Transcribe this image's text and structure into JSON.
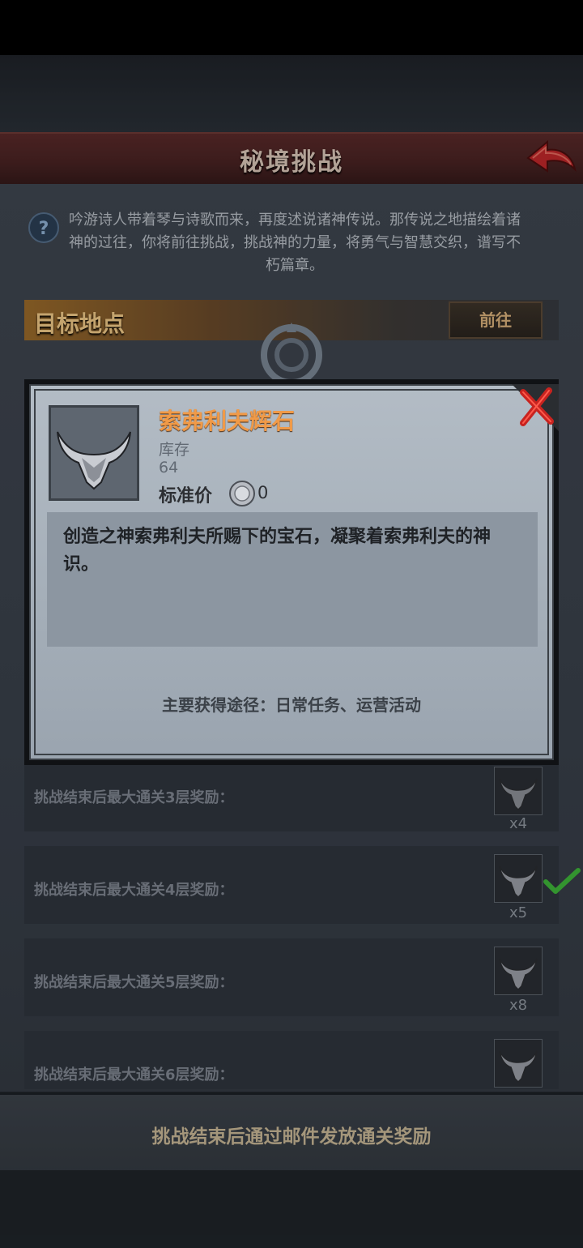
{
  "header": {
    "title": "秘境挑战"
  },
  "intro": {
    "text": "吟游诗人带着琴与诗歌而来，再度述说诸神传说。那传说之地描绘着诸神的过往，你将前往挑战，挑战神的力量，将勇气与智慧交织，谱写不朽篇章。"
  },
  "target": {
    "label": "目标地点",
    "goto_label": "前往"
  },
  "rewards": [
    {
      "label": "挑战结束后最大通关3层奖励：",
      "qty": "x4",
      "claimed": false
    },
    {
      "label": "挑战结束后最大通关4层奖励：",
      "qty": "x5",
      "claimed": true
    },
    {
      "label": "挑战结束后最大通关5层奖励：",
      "qty": "x8",
      "claimed": false
    },
    {
      "label": "挑战结束后最大通关6层奖励：",
      "qty": "",
      "claimed": false
    }
  ],
  "footer": {
    "text": "挑战结束后通过邮件发放通关奖励"
  },
  "modal": {
    "item_name": "索弗利夫辉石",
    "stock_label": "库存",
    "stock_value": "64",
    "price_label": "标准价",
    "price_value": "0",
    "description": "创造之神索弗利夫所赐下的宝石，凝聚着索弗利夫的神识。",
    "source": "主要获得途径：日常任务、运营活动"
  },
  "colors": {
    "header_red": "#4a2323",
    "item_name_orange": "#f09a48",
    "target_gold": "#f0c987",
    "check_green": "#3fb53a",
    "close_red": "#c8231f"
  },
  "icons": [
    "question-icon",
    "back-arrow-icon",
    "close-icon",
    "bull-horn-gem-icon",
    "silver-coin-icon",
    "check-icon"
  ]
}
